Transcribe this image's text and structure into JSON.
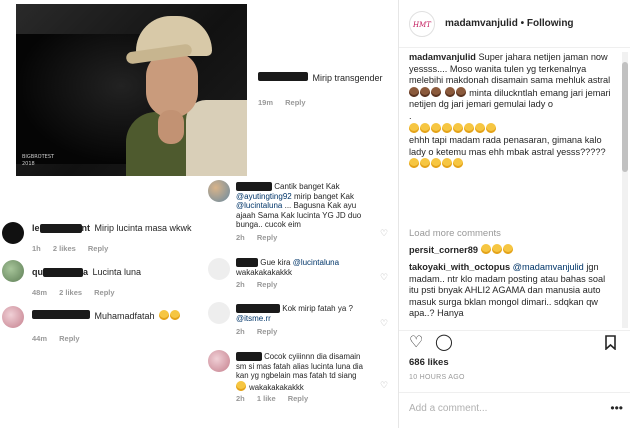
{
  "photo": {
    "watermark_line1": "BIGBROTEST",
    "watermark_line2": "2018"
  },
  "collage": {
    "c1": {
      "text": "Mirip transgender",
      "time": "19m",
      "reply": "Reply"
    },
    "c2": {
      "user_suffix": "nt",
      "text": "Mirip lucinta masa wkwk",
      "time": "1h",
      "likes": "2 likes",
      "reply": "Reply"
    },
    "c3": {
      "user_suffix": "a",
      "text": "Lucinta luna",
      "time": "48m",
      "likes": "2 likes",
      "reply": "Reply"
    },
    "c4": {
      "text": "Muhamadfatah",
      "time": "44m",
      "reply": "Reply"
    },
    "c5": {
      "text1": "Cantik banget Kak",
      "mention": "@ayutingting92",
      "text2": "mirip banget Kak",
      "mention2": "@lucintaluna",
      "text3": "... Bagusna Kak ayu ajaah Sama Kak lucinta YG JD duo bunga.. cucok eim",
      "time": "2h",
      "reply": "Reply"
    },
    "c6": {
      "text": "Gue kira",
      "mention": "@lucintaluna",
      "text2": "wakakakakakkk",
      "time": "2h",
      "reply": "Reply"
    },
    "c7": {
      "text": "Kok mirip fatah ya ?",
      "mention": "@itsme.rr",
      "time": "2h",
      "reply": "Reply"
    },
    "c8": {
      "text": "Cocok cyiiinnn dia disamain sm si mas fatah alias lucinta luna dia kan yg ngbelain mas fatah td siang",
      "text2": "wakakakakakkk",
      "time": "2h",
      "likes": "1 like",
      "reply": "Reply"
    }
  },
  "post": {
    "avatar_text": "HMT",
    "username": "madamvanjulid",
    "separator": " • ",
    "follow": "Following",
    "caption_user": "madamvanjulid",
    "caption_p1": "Super jahara netijen jaman now yessss.... Moso wanita tulen yg terkenalnya melebihi makdonah disamain sama mehluk astral",
    "caption_p2": "minta diluckntlah emang jari jemari netijen dg jari jemari gemulai lady o",
    "caption_p3": ".",
    "caption_p4": "ehhh tapi madam rada penasaran, gimana kalo lady o ketemu mas ehh mbak astral yesss?????",
    "load_more": "Load more comments",
    "comments": [
      {
        "user": "persit_corner89",
        "text": ""
      },
      {
        "user": "takoyaki_with_octopus",
        "mention": "@madamvanjulid",
        "text": "jgn madam.. ntr klo madam posting atau bahas soal itu psti bnyak AHLI2 AGAMA dan manusia auto masuk surga bklan mongol dimari.. sdqkan qw apa..? Hanya"
      }
    ],
    "likes": "686 likes",
    "time_ago": "10 HOURS AGO",
    "add_comment_placeholder": "Add a comment...",
    "more": "•••"
  }
}
